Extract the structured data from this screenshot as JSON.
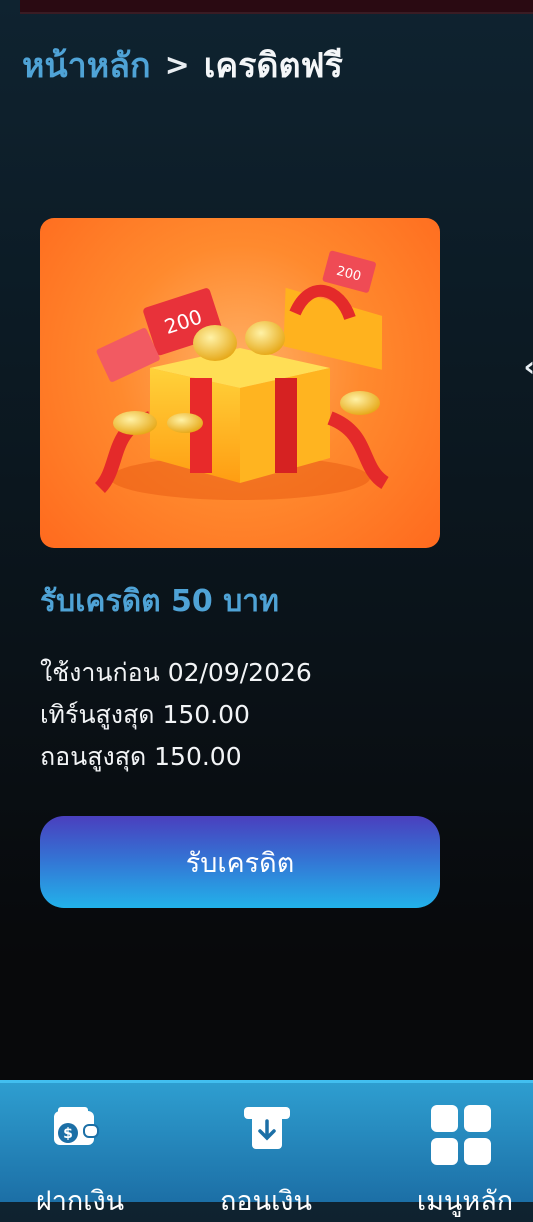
{
  "breadcrumb": {
    "home": "หน้าหลัก",
    "separator": ">",
    "current": "เครดิตฟรี"
  },
  "promo": {
    "image_alt": "gift box with coins and vouchers",
    "title": "รับเครดิต 50 บาท",
    "details": [
      "ใช้งานก่อน 02/09/2026",
      "เทิร์นสูงสุด 150.00",
      "ถอนสูงสุด 150.00"
    ],
    "claim_button": "รับเครดิต"
  },
  "bottom_nav": {
    "items": [
      {
        "label": "ฝากเงิน",
        "icon": "deposit-wallet-icon"
      },
      {
        "label": "ถอนเงิน",
        "icon": "withdraw-icon"
      },
      {
        "label": "เมนูหลัก",
        "icon": "main-menu-grid-icon"
      }
    ]
  },
  "colors": {
    "accent_blue": "#4fa3d6",
    "button_gradient_top": "#4a3fbe",
    "button_gradient_bottom": "#22b2ea",
    "nav_bar": "#2e9ed0"
  }
}
